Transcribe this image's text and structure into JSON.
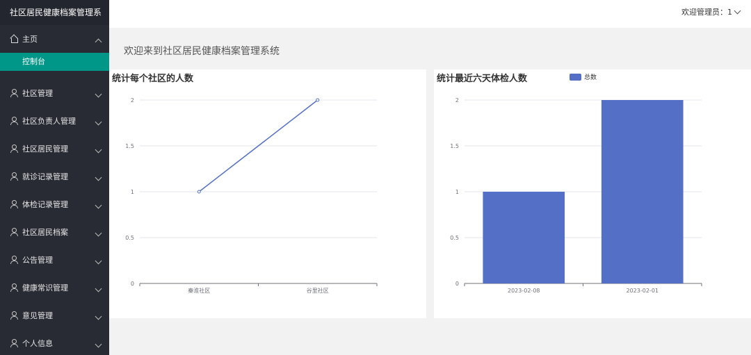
{
  "sidebar": {
    "brand": "社区居民健康档案管理系",
    "home": {
      "label": "主页",
      "icon": "home-icon",
      "sub": "控制台"
    },
    "items": [
      {
        "label": "社区管理",
        "icon": "user-icon"
      },
      {
        "label": "社区负责人管理",
        "icon": "user-icon"
      },
      {
        "label": "社区居民管理",
        "icon": "user-icon"
      },
      {
        "label": "就诊记录管理",
        "icon": "user-icon"
      },
      {
        "label": "体检记录管理",
        "icon": "user-icon"
      },
      {
        "label": "社区居民档案",
        "icon": "user-icon"
      },
      {
        "label": "公告管理",
        "icon": "user-icon"
      },
      {
        "label": "健康常识管理",
        "icon": "user-icon"
      },
      {
        "label": "意见管理",
        "icon": "user-icon"
      },
      {
        "label": "个人信息",
        "icon": "user-icon"
      }
    ]
  },
  "header": {
    "user_label": "欢迎管理员：1"
  },
  "main": {
    "welcome": "欢迎来到社区居民健康档案管理系统"
  },
  "chart_data": [
    {
      "type": "line",
      "title": "统计每个社区的人数",
      "categories": [
        "秦淮社区",
        "谷里社区"
      ],
      "values": [
        1,
        2
      ],
      "ylim": [
        0,
        2
      ],
      "yticks": [
        "0",
        "0.5",
        "1",
        "1.5",
        "2"
      ],
      "color": "#5470c6",
      "grid": true
    },
    {
      "type": "bar",
      "title": "统计最近六天体检人数",
      "categories": [
        "2023-02-08",
        "2023-02-01"
      ],
      "series": [
        {
          "name": "总数",
          "values": [
            1,
            2
          ]
        }
      ],
      "ylim": [
        0,
        2
      ],
      "yticks": [
        "0",
        "0.5",
        "1",
        "1.5",
        "2"
      ],
      "color": "#5470c6",
      "legend": "top",
      "grid": true
    }
  ]
}
